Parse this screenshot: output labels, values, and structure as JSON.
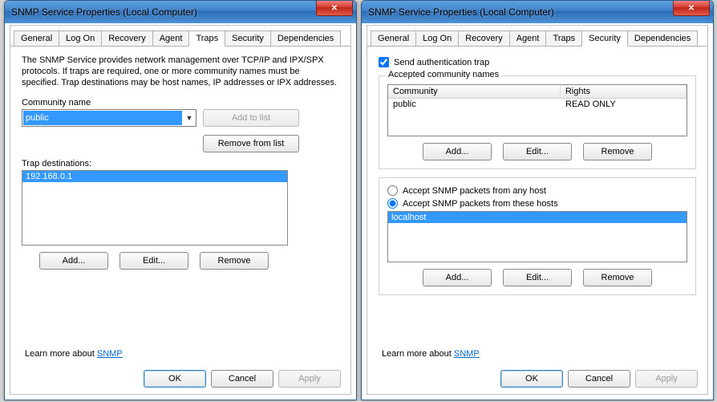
{
  "window_title": "SNMP Service Properties (Local Computer)",
  "tabs": {
    "general": "General",
    "logon": "Log On",
    "recovery": "Recovery",
    "agent": "Agent",
    "traps": "Traps",
    "security": "Security",
    "dependencies": "Dependencies"
  },
  "traps": {
    "description": "The SNMP Service provides network management over TCP/IP and IPX/SPX protocols. If traps are required, one or more community names must be specified. Trap destinations may be host names, IP addresses or IPX addresses.",
    "community_label": "Community name",
    "community_value": "public",
    "add_to_list": "Add to list",
    "remove_from_list": "Remove from list",
    "trap_dest_label": "Trap destinations:",
    "trap_dest_item": "192.168.0.1",
    "add": "Add...",
    "edit": "Edit...",
    "remove": "Remove"
  },
  "security": {
    "send_auth_trap": "Send authentication trap",
    "accepted_group": "Accepted community names",
    "col_community": "Community",
    "col_rights": "Rights",
    "row_community": "public",
    "row_rights": "READ ONLY",
    "add": "Add...",
    "edit": "Edit...",
    "remove": "Remove",
    "accept_any": "Accept SNMP packets from any host",
    "accept_these": "Accept SNMP packets from these hosts",
    "host_item": "localhost"
  },
  "learn_prefix": "Learn more about ",
  "learn_link": "SNMP",
  "buttons": {
    "ok": "OK",
    "cancel": "Cancel",
    "apply": "Apply"
  },
  "close_glyph": "✕"
}
